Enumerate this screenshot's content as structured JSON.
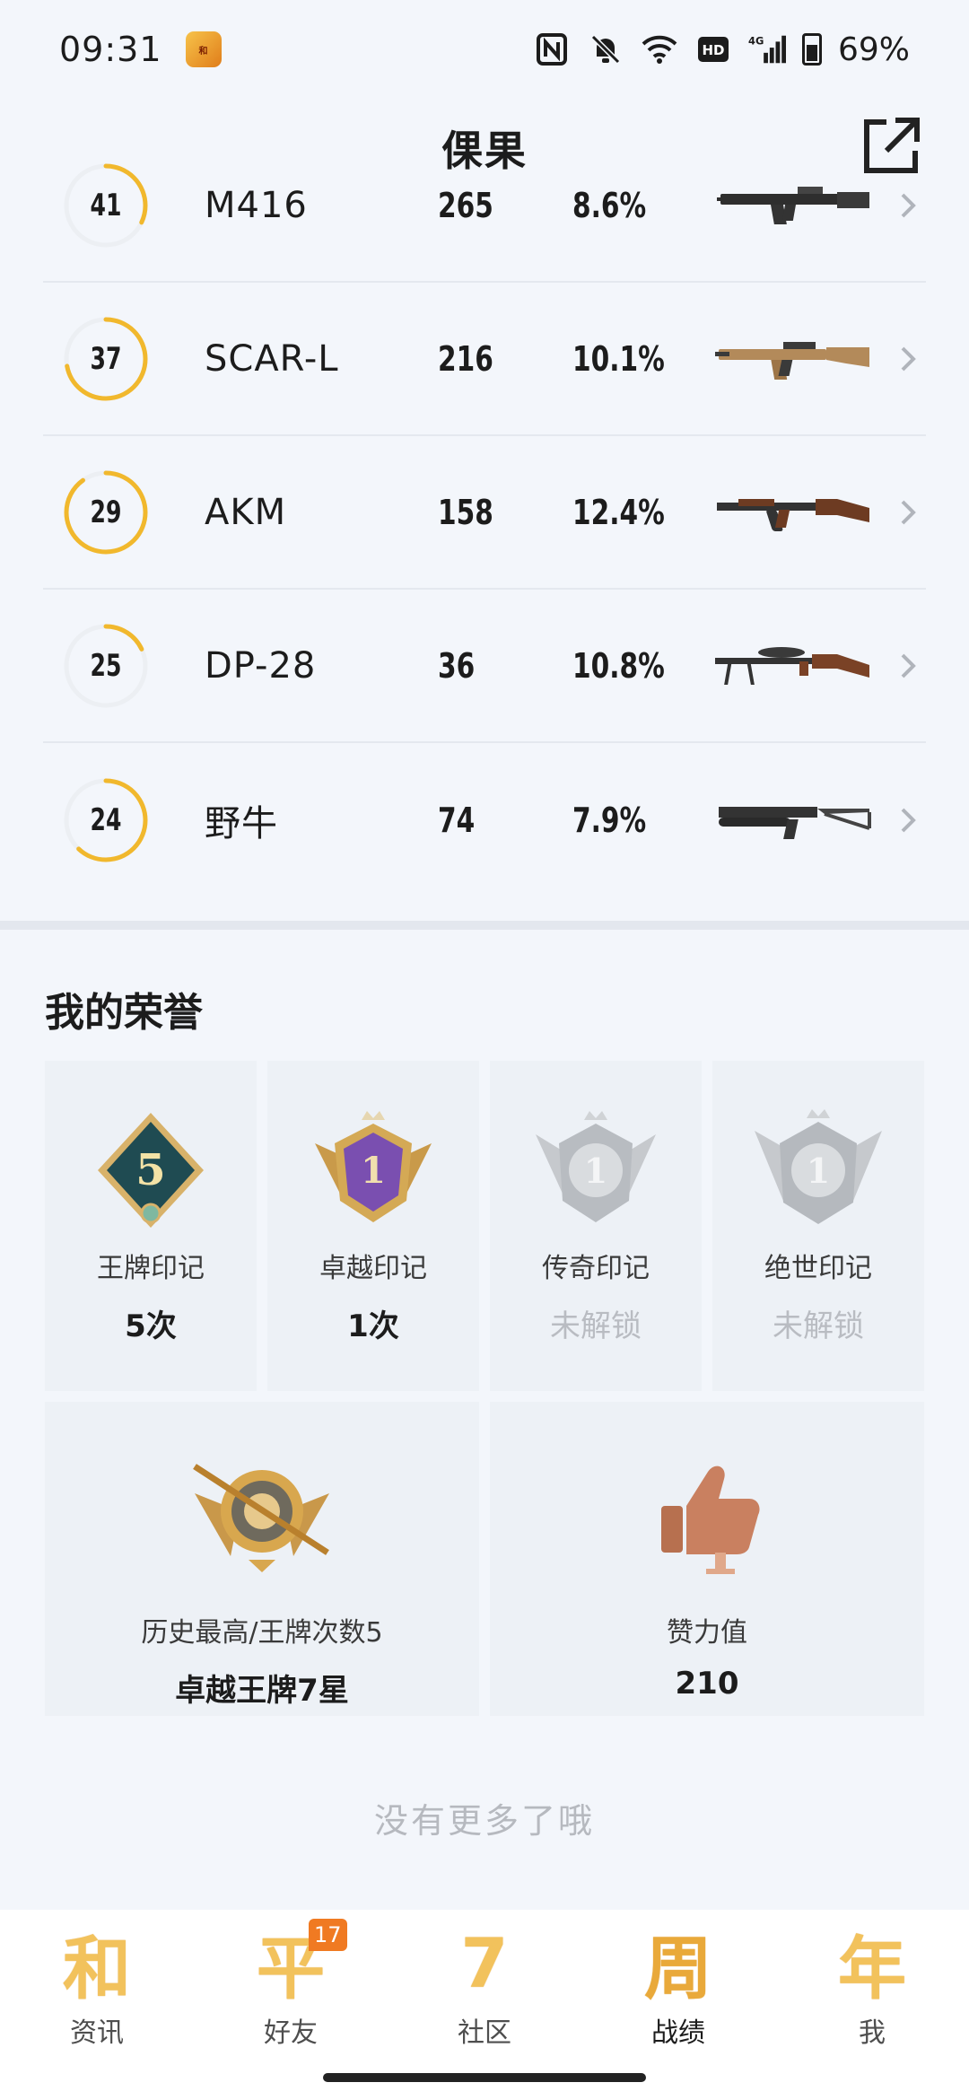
{
  "status_bar": {
    "time": "09:31",
    "battery": "69%",
    "icons": [
      "nfc-icon",
      "mute-bell-icon",
      "wifi-icon",
      "hd-icon",
      "signal-4g-icon",
      "battery-icon"
    ]
  },
  "header": {
    "title": "倮果",
    "share_icon": "share-icon"
  },
  "weapons": [
    {
      "level": "41",
      "progress": 0.32,
      "name": "M416",
      "kills": "265",
      "rate": "8.6%"
    },
    {
      "level": "37",
      "progress": 0.72,
      "name": "SCAR-L",
      "kills": "216",
      "rate": "10.1%"
    },
    {
      "level": "29",
      "progress": 0.9,
      "name": "AKM",
      "kills": "158",
      "rate": "12.4%"
    },
    {
      "level": "25",
      "progress": 0.18,
      "name": "DP-28",
      "kills": "36",
      "rate": "10.8%"
    },
    {
      "level": "24",
      "progress": 0.62,
      "name": "野牛",
      "kills": "74",
      "rate": "7.9%"
    }
  ],
  "honors": {
    "title": "我的荣誉",
    "marks": [
      {
        "label": "王牌印记",
        "value": "5次",
        "locked": false
      },
      {
        "label": "卓越印记",
        "value": "1次",
        "locked": false
      },
      {
        "label": "传奇印记",
        "value": "未解锁",
        "locked": true
      },
      {
        "label": "绝世印记",
        "value": "未解锁",
        "locked": true
      }
    ],
    "highest": {
      "label": "历史最高/王牌次数5",
      "value": "卓越王牌7星"
    },
    "likes": {
      "label": "赞力值",
      "value": "210"
    }
  },
  "no_more": "没有更多了哦",
  "nav": {
    "items": [
      {
        "glyph": "和",
        "label": "资讯"
      },
      {
        "glyph": "平",
        "label": "好友",
        "badge": "17"
      },
      {
        "glyph": "7",
        "label": "社区"
      },
      {
        "glyph": "周",
        "label": "战绩"
      },
      {
        "glyph": "年",
        "label": "我"
      }
    ]
  },
  "colors": {
    "accent": "#f1b82d",
    "background": "#f3f6fb",
    "card": "#edf1f6"
  }
}
